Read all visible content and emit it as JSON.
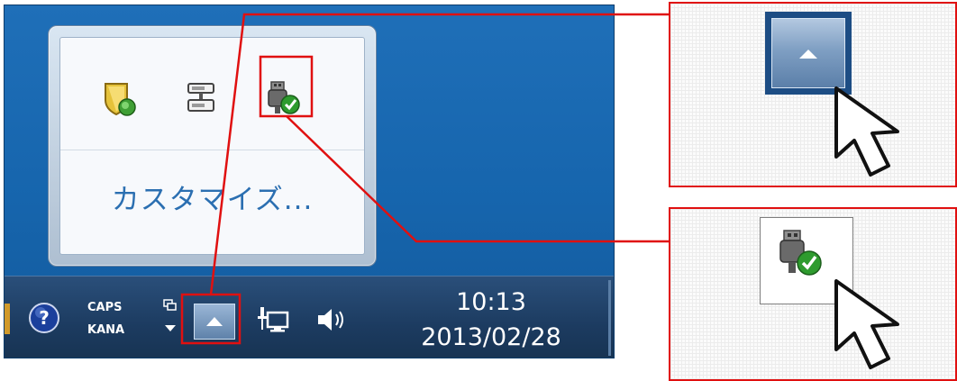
{
  "popup": {
    "icons": [
      "security-shield-icon",
      "safely-remove-hardware-icon",
      "usb-connected-icon"
    ],
    "customize_label": "カスタマイズ..."
  },
  "taskbar": {
    "ime_caps": "CAPS",
    "ime_kana": "KANA",
    "time": "10:13",
    "date": "2013/02/28",
    "icons": [
      "help-icon",
      "show-hidden-icons-button",
      "network-icon",
      "volume-icon"
    ]
  },
  "colors": {
    "highlight": "#e01010",
    "desktop": "#1f6fb8",
    "taskbar": "#1c3b60",
    "link": "#2b6fb1"
  }
}
